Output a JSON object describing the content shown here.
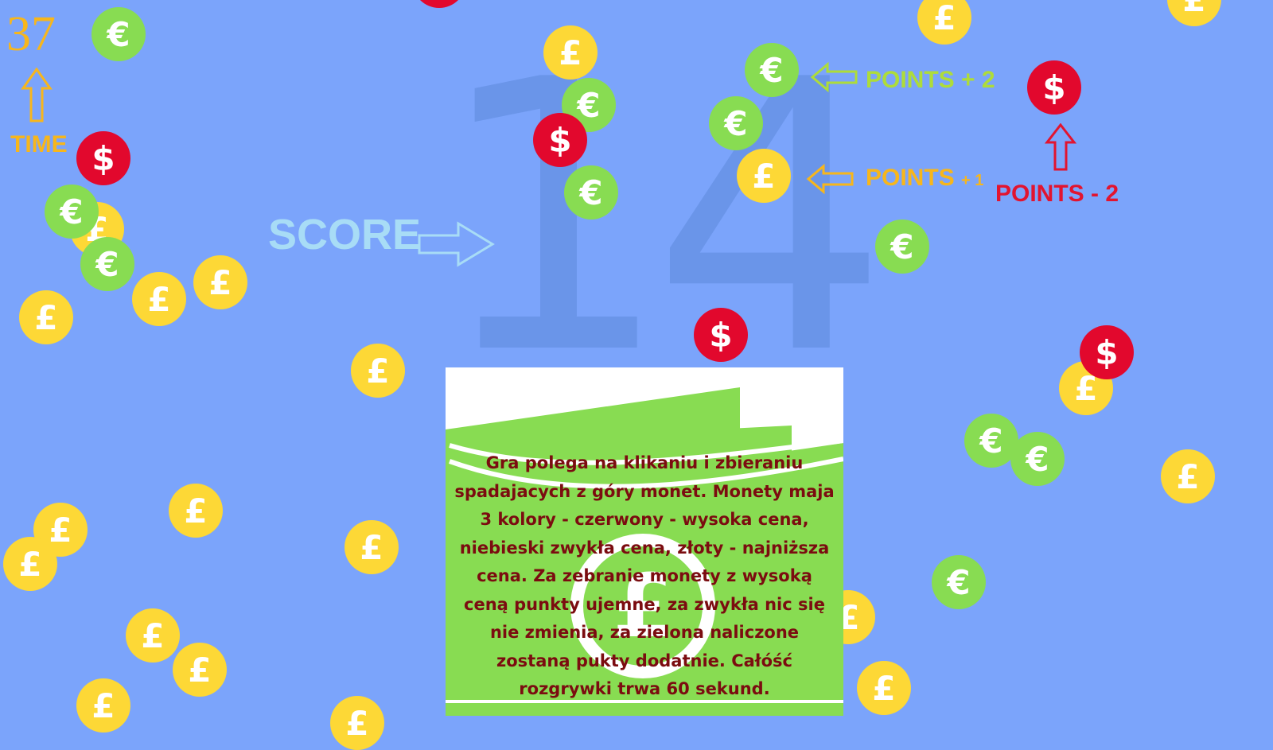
{
  "game": {
    "score": "14",
    "score_label": "SCORE",
    "time": "37",
    "time_label": "TIME"
  },
  "legend": {
    "green": {
      "label": "POINTS + 2"
    },
    "gold": {
      "label": "POINTS",
      "label_suffix": "+ 1"
    },
    "red": {
      "label": "POINTS - 2"
    }
  },
  "coin_symbols": {
    "gold": "£",
    "green": "€",
    "red": "$"
  },
  "colors": {
    "background": "#7ba4fb",
    "gold": "#fdd836",
    "green": "#88dc52",
    "red": "#e2082d",
    "time": "#f7b61c",
    "score_label": "#a8dcf6",
    "big_score": "#6a95e9",
    "instructions_text": "#7b0c10"
  },
  "icons": {
    "time_arrow": "arrow-up-icon",
    "score_arrow": "arrow-right-icon",
    "points_arrow": "arrow-left-icon",
    "red_arrow": "arrow-up-icon",
    "panel_art": "pound-banknote-icon"
  },
  "instructions": "Gra polega na klikaniu i zbieraniu spadajacych z góry monet. Monety maja 3 kolory - czerwony - wysoka cena, niebieski zwykła cena, złoty - najniższa cena. Za zebranie monety z wysoką ceną punkty ujemne, za zwykła nic się nie zmienia, za zielona naliczone zostaną pukty dodatnie. Całóść rozgrywki trwa 60 sekund."
}
